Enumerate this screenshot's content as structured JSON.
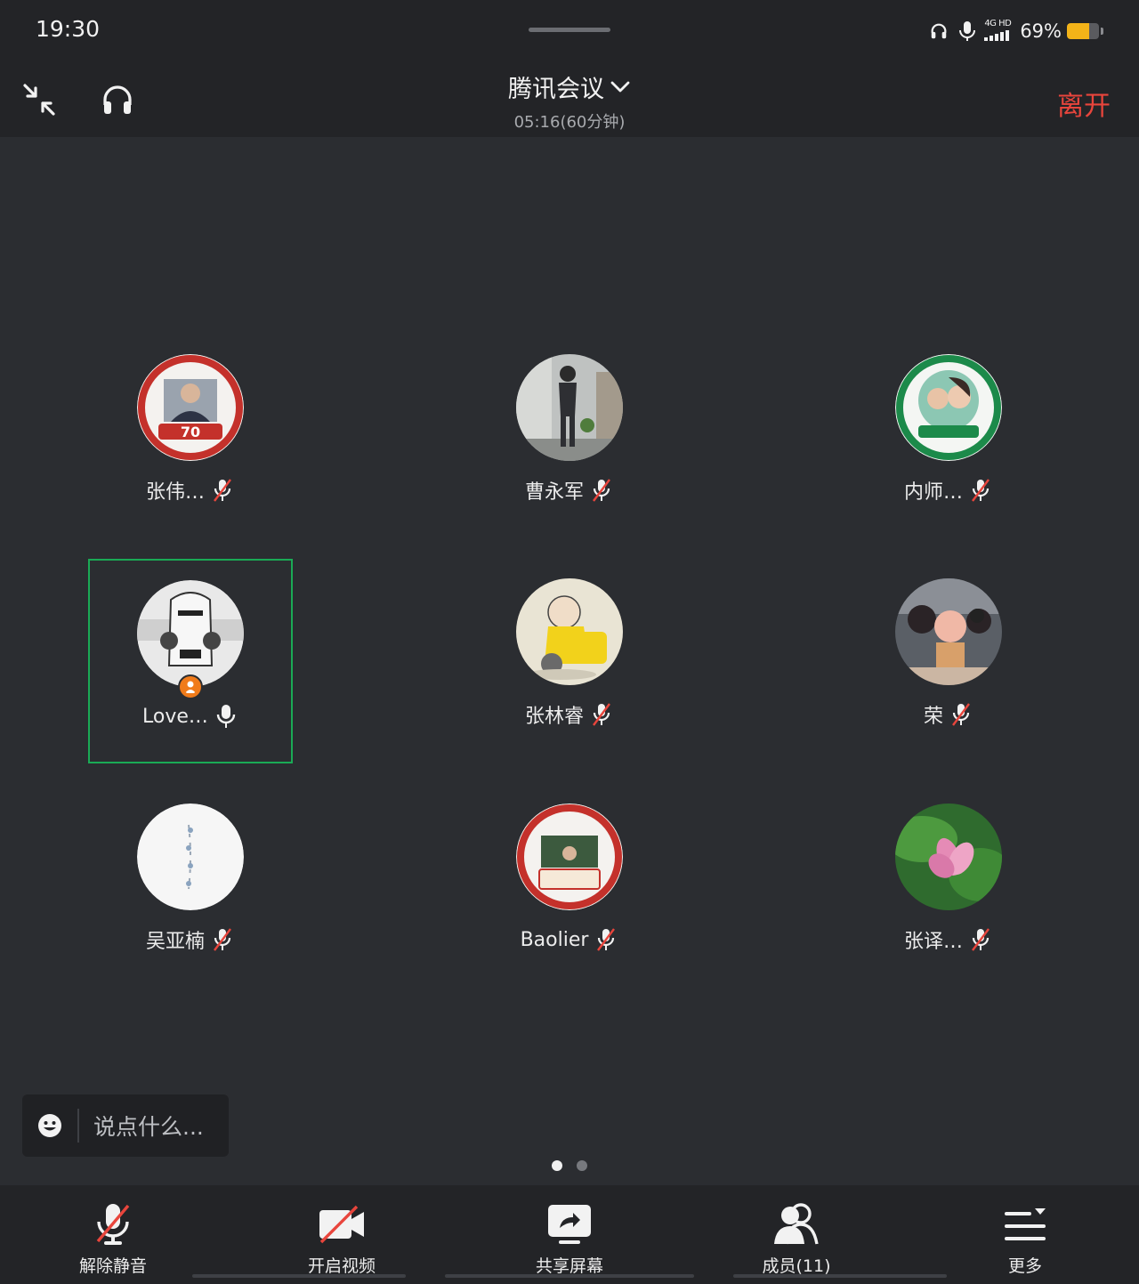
{
  "status_bar": {
    "time": "19:30",
    "network_type": "4G HD",
    "battery_percent": "69%",
    "battery_level": 0.69,
    "icons": [
      "headphone-icon",
      "mic-icon",
      "signal-icon",
      "battery-icon"
    ]
  },
  "header": {
    "title": "腾讯会议",
    "timer": "05:16(60分钟)",
    "leave_label": "离开",
    "colors": {
      "leave": "#e8453c"
    }
  },
  "participants": [
    {
      "name": "张伟…",
      "mic": "muted"
    },
    {
      "name": "曹永军",
      "mic": "muted"
    },
    {
      "name": "内师…",
      "mic": "muted"
    },
    {
      "name": "Love…",
      "mic": "on",
      "host": true,
      "active_speaker": true
    },
    {
      "name": "张林睿",
      "mic": "muted"
    },
    {
      "name": "荣",
      "mic": "muted"
    },
    {
      "name": "吴亚楠",
      "mic": "muted"
    },
    {
      "name": "Baolier",
      "mic": "muted"
    },
    {
      "name": "张译…",
      "mic": "muted"
    }
  ],
  "chat": {
    "placeholder": "说点什么..."
  },
  "pagination": {
    "current": 1,
    "total": 2
  },
  "toolbar": {
    "unmute_label": "解除静音",
    "video_label": "开启视频",
    "share_label": "共享屏幕",
    "members_label": "成员(11)",
    "more_label": "更多"
  },
  "colors": {
    "active_border": "#1aaa55",
    "host_badge": "#f07b1a",
    "muted_slash": "#e8453c"
  }
}
